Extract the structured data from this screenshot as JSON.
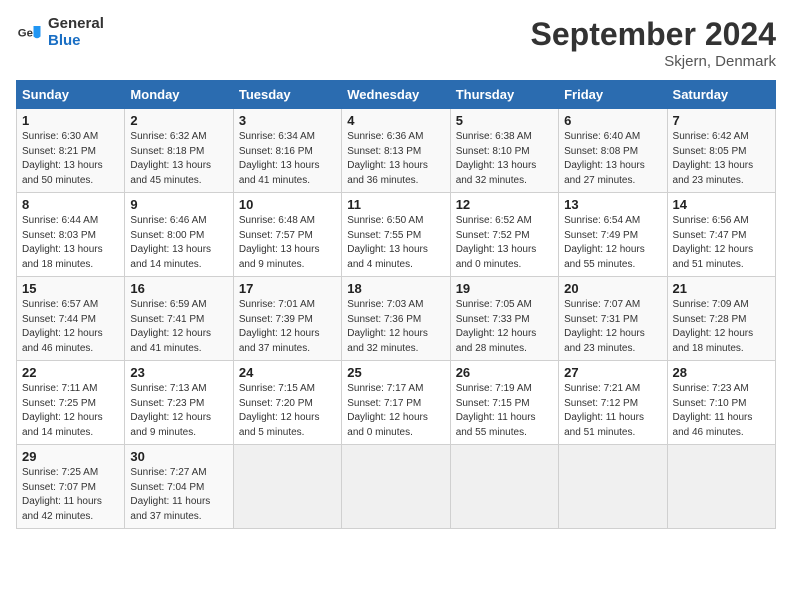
{
  "header": {
    "logo_general": "General",
    "logo_blue": "Blue",
    "month_title": "September 2024",
    "location": "Skjern, Denmark"
  },
  "days_of_week": [
    "Sunday",
    "Monday",
    "Tuesday",
    "Wednesday",
    "Thursday",
    "Friday",
    "Saturday"
  ],
  "weeks": [
    [
      {
        "day": "1",
        "sunrise": "6:30 AM",
        "sunset": "8:21 PM",
        "daylight": "13 hours and 50 minutes."
      },
      {
        "day": "2",
        "sunrise": "6:32 AM",
        "sunset": "8:18 PM",
        "daylight": "13 hours and 45 minutes."
      },
      {
        "day": "3",
        "sunrise": "6:34 AM",
        "sunset": "8:16 PM",
        "daylight": "13 hours and 41 minutes."
      },
      {
        "day": "4",
        "sunrise": "6:36 AM",
        "sunset": "8:13 PM",
        "daylight": "13 hours and 36 minutes."
      },
      {
        "day": "5",
        "sunrise": "6:38 AM",
        "sunset": "8:10 PM",
        "daylight": "13 hours and 32 minutes."
      },
      {
        "day": "6",
        "sunrise": "6:40 AM",
        "sunset": "8:08 PM",
        "daylight": "13 hours and 27 minutes."
      },
      {
        "day": "7",
        "sunrise": "6:42 AM",
        "sunset": "8:05 PM",
        "daylight": "13 hours and 23 minutes."
      }
    ],
    [
      {
        "day": "8",
        "sunrise": "6:44 AM",
        "sunset": "8:03 PM",
        "daylight": "13 hours and 18 minutes."
      },
      {
        "day": "9",
        "sunrise": "6:46 AM",
        "sunset": "8:00 PM",
        "daylight": "13 hours and 14 minutes."
      },
      {
        "day": "10",
        "sunrise": "6:48 AM",
        "sunset": "7:57 PM",
        "daylight": "13 hours and 9 minutes."
      },
      {
        "day": "11",
        "sunrise": "6:50 AM",
        "sunset": "7:55 PM",
        "daylight": "13 hours and 4 minutes."
      },
      {
        "day": "12",
        "sunrise": "6:52 AM",
        "sunset": "7:52 PM",
        "daylight": "13 hours and 0 minutes."
      },
      {
        "day": "13",
        "sunrise": "6:54 AM",
        "sunset": "7:49 PM",
        "daylight": "12 hours and 55 minutes."
      },
      {
        "day": "14",
        "sunrise": "6:56 AM",
        "sunset": "7:47 PM",
        "daylight": "12 hours and 51 minutes."
      }
    ],
    [
      {
        "day": "15",
        "sunrise": "6:57 AM",
        "sunset": "7:44 PM",
        "daylight": "12 hours and 46 minutes."
      },
      {
        "day": "16",
        "sunrise": "6:59 AM",
        "sunset": "7:41 PM",
        "daylight": "12 hours and 41 minutes."
      },
      {
        "day": "17",
        "sunrise": "7:01 AM",
        "sunset": "7:39 PM",
        "daylight": "12 hours and 37 minutes."
      },
      {
        "day": "18",
        "sunrise": "7:03 AM",
        "sunset": "7:36 PM",
        "daylight": "12 hours and 32 minutes."
      },
      {
        "day": "19",
        "sunrise": "7:05 AM",
        "sunset": "7:33 PM",
        "daylight": "12 hours and 28 minutes."
      },
      {
        "day": "20",
        "sunrise": "7:07 AM",
        "sunset": "7:31 PM",
        "daylight": "12 hours and 23 minutes."
      },
      {
        "day": "21",
        "sunrise": "7:09 AM",
        "sunset": "7:28 PM",
        "daylight": "12 hours and 18 minutes."
      }
    ],
    [
      {
        "day": "22",
        "sunrise": "7:11 AM",
        "sunset": "7:25 PM",
        "daylight": "12 hours and 14 minutes."
      },
      {
        "day": "23",
        "sunrise": "7:13 AM",
        "sunset": "7:23 PM",
        "daylight": "12 hours and 9 minutes."
      },
      {
        "day": "24",
        "sunrise": "7:15 AM",
        "sunset": "7:20 PM",
        "daylight": "12 hours and 5 minutes."
      },
      {
        "day": "25",
        "sunrise": "7:17 AM",
        "sunset": "7:17 PM",
        "daylight": "12 hours and 0 minutes."
      },
      {
        "day": "26",
        "sunrise": "7:19 AM",
        "sunset": "7:15 PM",
        "daylight": "11 hours and 55 minutes."
      },
      {
        "day": "27",
        "sunrise": "7:21 AM",
        "sunset": "7:12 PM",
        "daylight": "11 hours and 51 minutes."
      },
      {
        "day": "28",
        "sunrise": "7:23 AM",
        "sunset": "7:10 PM",
        "daylight": "11 hours and 46 minutes."
      }
    ],
    [
      {
        "day": "29",
        "sunrise": "7:25 AM",
        "sunset": "7:07 PM",
        "daylight": "11 hours and 42 minutes."
      },
      {
        "day": "30",
        "sunrise": "7:27 AM",
        "sunset": "7:04 PM",
        "daylight": "11 hours and 37 minutes."
      },
      null,
      null,
      null,
      null,
      null
    ]
  ]
}
